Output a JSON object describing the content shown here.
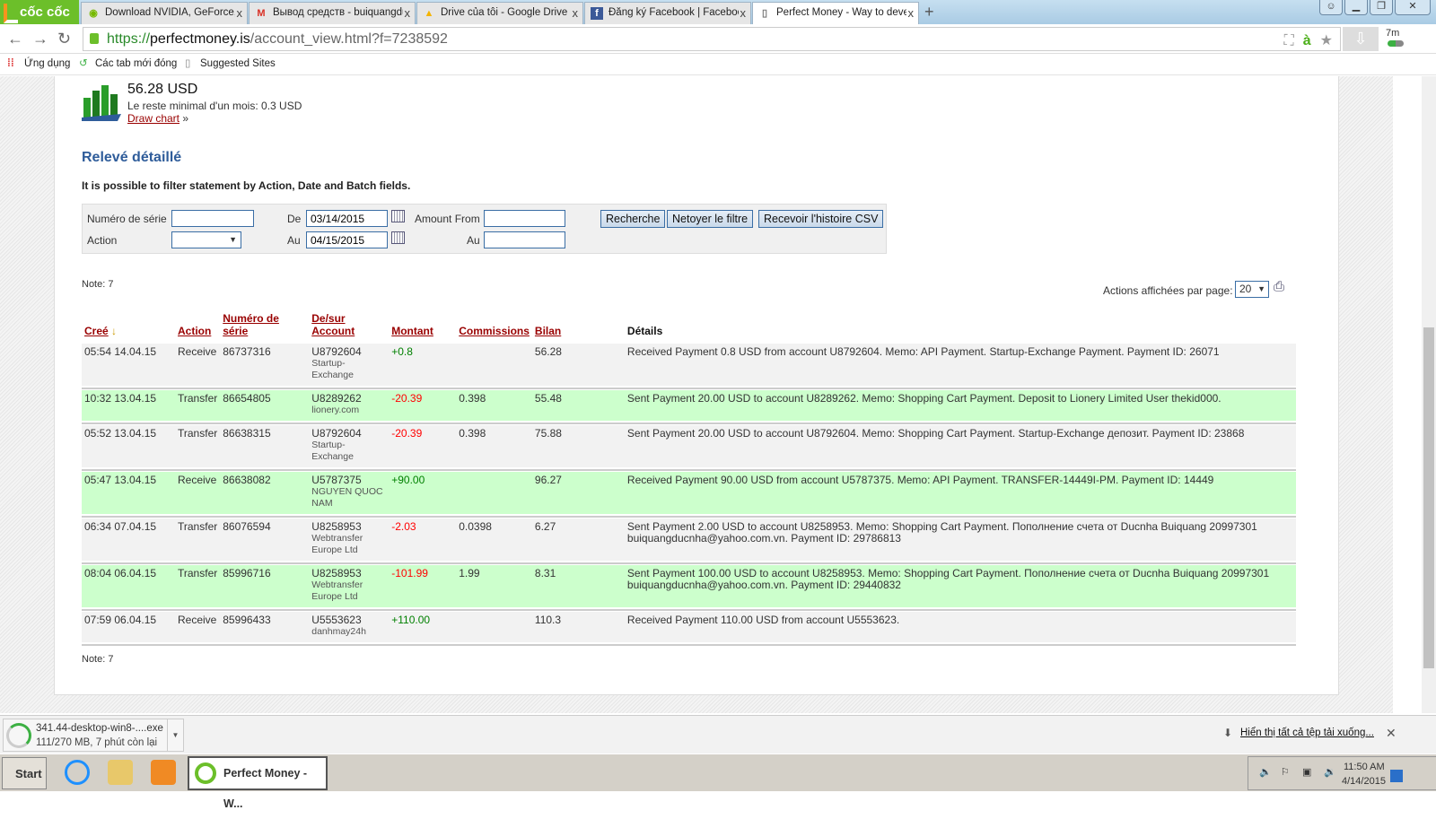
{
  "browser": {
    "brand": "cốc cốc",
    "tabs": [
      {
        "label": "Download NVIDIA, GeForce,",
        "icon": "nvidia-icon"
      },
      {
        "label": "Вывод средств - buiquangdu",
        "icon": "gmail-icon"
      },
      {
        "label": "Drive của tôi - Google Drive",
        "icon": "google-drive-icon"
      },
      {
        "label": "Đăng ký Facebook | Faceboo",
        "icon": "facebook-icon"
      },
      {
        "label": "Perfect Money - Way to deve",
        "icon": "page-icon",
        "active": true
      }
    ],
    "url": {
      "scheme": "https://",
      "domain": "perfectmoney.is",
      "path": "/account_view.html?f=7238592"
    },
    "ext_badge": "7m",
    "bookmarks": [
      "Ứng dụng",
      "Các tab mới đóng",
      "Suggested Sites"
    ]
  },
  "page": {
    "balance": "56.28 USD",
    "min_balance": "Le reste minimal d'un mois: 0.3 USD",
    "draw_chart": "Draw chart",
    "draw_chart_arrow": "»",
    "section_title": "Relevé détaillé",
    "filter_hint": "It is possible to filter statement by Action, Date and Batch fields.",
    "filter": {
      "serial_label": "Numéro de série",
      "serial_value": "",
      "action_label": "Action",
      "action_value": "",
      "from_label": "De",
      "from_value": "03/14/2015",
      "to_label": "Au",
      "to_value": "04/15/2015",
      "amount_from_label": "Amount From",
      "amount_from_value": "",
      "amount_to_label": "Au",
      "amount_to_value": "",
      "search_button": "Recherche",
      "clear_button": "Netoyer le filtre",
      "csv_button": "Recevoir l'histoire CSV"
    },
    "note_top": "Note: 7",
    "note_bottom": "Note: 7",
    "per_page_label": "Actions affichées par page:",
    "per_page_value": "20",
    "columns": {
      "created": "Creé",
      "sort_arrow": "↓",
      "action": "Action",
      "serial": "Numéro de série",
      "account_line1": "De/sur",
      "account_line2": "Account",
      "amount": "Montant",
      "commissions": "Commissions",
      "balance": "Bilan",
      "details": "Détails"
    },
    "rows": [
      {
        "created": "05:54 14.04.15",
        "action": "Receive",
        "serial": "86737316",
        "account": "U8792604",
        "account_name": "Startup-Exchange",
        "amount": "+0.8",
        "commission": "",
        "balance": "56.28",
        "details": "Received Payment 0.8 USD from account U8792604. Memo: API Payment. Startup-Exchange Payment. Payment ID: 26071"
      },
      {
        "created": "10:32 13.04.15",
        "action": "Transfer",
        "serial": "86654805",
        "account": "U8289262",
        "account_name": "lionery.com",
        "amount": "-20.39",
        "commission": "0.398",
        "balance": "55.48",
        "details": "Sent Payment 20.00 USD to account U8289262. Memo: Shopping Cart Payment. Deposit to Lionery Limited User thekid000."
      },
      {
        "created": "05:52 13.04.15",
        "action": "Transfer",
        "serial": "86638315",
        "account": "U8792604",
        "account_name": "Startup-Exchange",
        "amount": "-20.39",
        "commission": "0.398",
        "balance": "75.88",
        "details": "Sent Payment 20.00 USD to account U8792604. Memo: Shopping Cart Payment. Startup-Exchange депозит. Payment ID: 23868"
      },
      {
        "created": "05:47 13.04.15",
        "action": "Receive",
        "serial": "86638082",
        "account": "U5787375",
        "account_name": "NGUYEN QUOC NAM",
        "amount": "+90.00",
        "commission": "",
        "balance": "96.27",
        "details": "Received Payment 90.00 USD from account U5787375. Memo: API Payment. TRANSFER-14449I-PM. Payment ID: 14449"
      },
      {
        "created": "06:34 07.04.15",
        "action": "Transfer",
        "serial": "86076594",
        "account": "U8258953",
        "account_name": "Webtransfer Europe Ltd",
        "amount": "-2.03",
        "commission": "0.0398",
        "balance": "6.27",
        "details": "Sent Payment 2.00 USD to account U8258953. Memo: Shopping Cart Payment. Пополнение счета от Ducnha Buiquang 20997301 buiquangducnha@yahoo.com.vn. Payment ID: 29786813"
      },
      {
        "created": "08:04 06.04.15",
        "action": "Transfer",
        "serial": "85996716",
        "account": "U8258953",
        "account_name": "Webtransfer Europe Ltd",
        "amount": "-101.99",
        "commission": "1.99",
        "balance": "8.31",
        "details": "Sent Payment 100.00 USD to account U8258953. Memo: Shopping Cart Payment. Пополнение счета от Ducnha Buiquang 20997301 buiquangducnha@yahoo.com.vn. Payment ID: 29440832"
      },
      {
        "created": "07:59 06.04.15",
        "action": "Receive",
        "serial": "85996433",
        "account": "U5553623",
        "account_name": "danhmay24h",
        "amount": "+110.00",
        "commission": "",
        "balance": "110.3",
        "details": "Received Payment 110.00 USD from account U5553623."
      }
    ]
  },
  "downloads": {
    "file": "341.44-desktop-win8-....exe",
    "progress_text": "111/270 MB, 7 phút còn lại",
    "progress": 0.41,
    "show_all": "Hiển thị tất cả tệp tải xuống..."
  },
  "taskbar": {
    "start": "Start",
    "app": "Perfect Money - W...",
    "time": "11:50 AM",
    "date": "4/14/2015"
  },
  "colors": {
    "link": "#990000",
    "title": "#2e5c9a",
    "positive": "#008000",
    "negative": "#ff0000",
    "row_green": "#ccffcc",
    "row_grey": "#f2f2f2"
  }
}
